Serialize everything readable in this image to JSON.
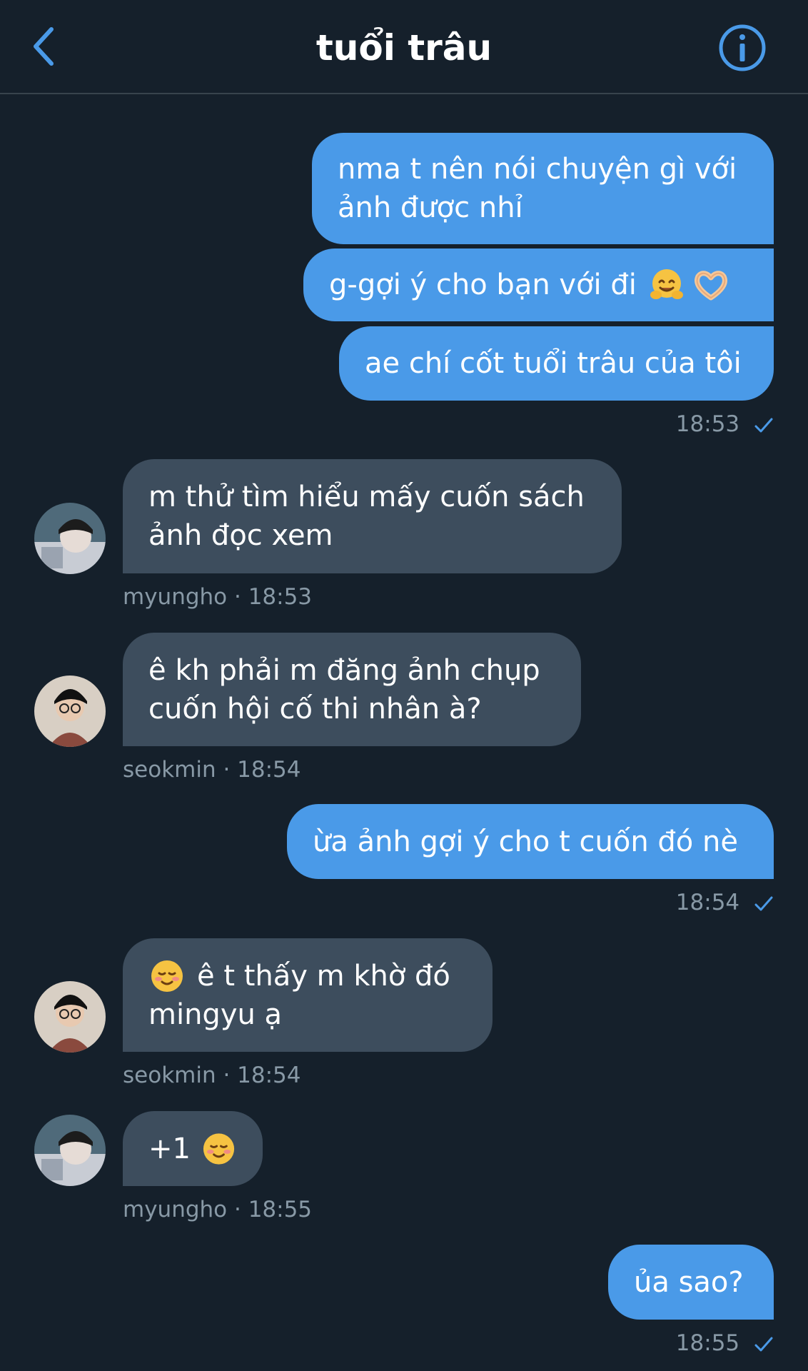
{
  "header": {
    "title": "tuổi trâu",
    "back_icon": "chevron-left-icon",
    "info_icon": "info-icon",
    "accent_color": "#4a9ae8"
  },
  "messages": [
    {
      "side": "out",
      "lines": [
        "nma t nên nói chuyện gì với",
        "ảnh được nhỉ"
      ]
    },
    {
      "side": "out",
      "text": "g-gợi ý cho bạn với đi",
      "emoji": [
        "hugging-face-emoji",
        "heart-hands-emoji"
      ]
    },
    {
      "side": "out",
      "text": "ae chí cốt tuổi trâu của tôi"
    },
    {
      "side": "in",
      "sender": "myungho",
      "lines": [
        "m thử tìm hiểu mấy cuốn sách",
        "ảnh đọc xem"
      ]
    },
    {
      "side": "in",
      "sender": "seokmin",
      "lines": [
        "ê kh phải m đăng ảnh chụp",
        "cuốn hội cố thi nhân à?"
      ]
    },
    {
      "side": "out",
      "text": "ừa ảnh gợi ý cho t cuốn đó nè"
    },
    {
      "side": "in",
      "sender": "seokmin",
      "lines": [
        "ê t thấy m khờ đó",
        "mingyu ạ"
      ],
      "emoji": [
        "smiling-face-emoji"
      ]
    },
    {
      "side": "in",
      "sender": "myungho",
      "text": "+1",
      "emoji": [
        "smiling-face-emoji"
      ]
    },
    {
      "side": "out",
      "text": "ủa sao?"
    }
  ],
  "meta": {
    "m1": "18:53",
    "m2": "myungho · 18:53",
    "m3": "seokmin · 18:54",
    "m4": "18:54",
    "m5": "seokmin · 18:54",
    "m6": "myungho · 18:55",
    "m7": "18:55"
  },
  "colors": {
    "background": "#15202b",
    "outgoing_bubble": "#4a9ae8",
    "incoming_bubble": "#3d4d5d",
    "meta_text": "#8899a6"
  }
}
